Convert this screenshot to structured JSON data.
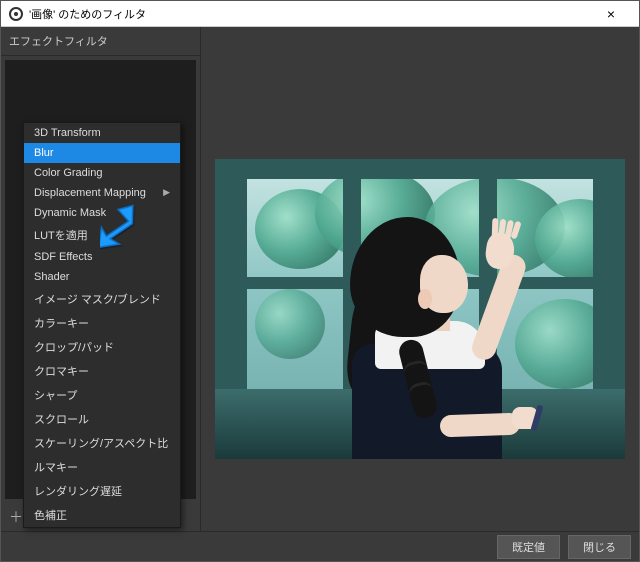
{
  "titlebar": {
    "title": "'画像' のためのフィルタ",
    "close": "×"
  },
  "sidebar": {
    "header": "エフェクトフィルタ",
    "toolbar": {
      "add": "＋",
      "remove": "−",
      "up": "⌃",
      "down": "⌄"
    }
  },
  "add_menu": {
    "items": [
      {
        "label": "3D Transform"
      },
      {
        "label": "Blur",
        "selected": true
      },
      {
        "label": "Color Grading"
      },
      {
        "label": "Displacement Mapping",
        "submenu": true
      },
      {
        "label": "Dynamic Mask"
      },
      {
        "label": "LUTを適用"
      },
      {
        "label": "SDF Effects"
      },
      {
        "label": "Shader"
      },
      {
        "label": "イメージ マスク/ブレンド"
      },
      {
        "label": "カラーキー"
      },
      {
        "label": "クロップ/パッド"
      },
      {
        "label": "クロマキー"
      },
      {
        "label": "シャープ"
      },
      {
        "label": "スクロール"
      },
      {
        "label": "スケーリング/アスペクト比"
      },
      {
        "label": "ルマキー"
      },
      {
        "label": "レンダリング遅延"
      },
      {
        "label": "色補正"
      }
    ]
  },
  "footer": {
    "defaults": "既定値",
    "close": "閉じる"
  },
  "annotation": {
    "arrow_color": "#1e9cff"
  }
}
